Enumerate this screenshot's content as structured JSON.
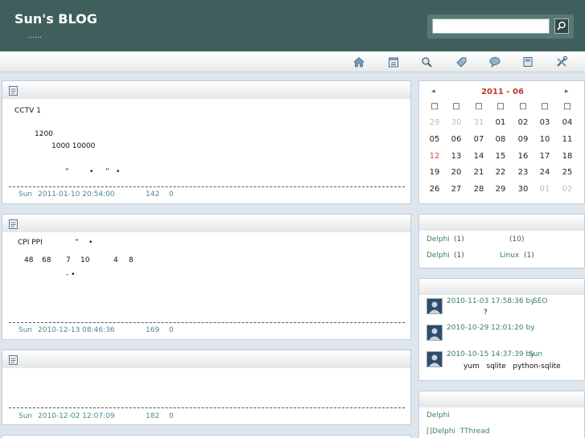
{
  "header": {
    "title": "Sun's BLOG",
    "subtitle": "……",
    "search_placeholder": ""
  },
  "nav": {
    "icons": [
      "home-icon",
      "calendar-icon",
      "search-icon",
      "tag-icon",
      "comment-icon",
      "archive-icon",
      "tools-icon"
    ]
  },
  "posts": [
    {
      "lines": [
        "CCTV 1",
        "1200",
        "1000 10000",
        "”",
        "•",
        "”",
        "•"
      ],
      "author": "Sun",
      "date": "2011-01-10 20:54:00",
      "views": "142",
      "comments": "0"
    },
    {
      "lines": [
        "CPI PPI",
        "”",
        "•",
        "48",
        "68",
        "7",
        "10",
        "4",
        "8",
        "- •"
      ],
      "author": "Sun",
      "date": "2010-12-13 08:46:36",
      "views": "169",
      "comments": "0"
    },
    {
      "lines": [],
      "author": "Sun",
      "date": "2010-12-02 12:07:09",
      "views": "182",
      "comments": "0"
    }
  ],
  "calendar": {
    "title": "2011 - 06",
    "prev": "◂",
    "next": "▸",
    "weekdays": [
      "□",
      "□",
      "□",
      "□",
      "□",
      "□",
      "□"
    ],
    "rows": [
      [
        "29",
        "30",
        "31",
        "01",
        "02",
        "03",
        "04"
      ],
      [
        "05",
        "06",
        "07",
        "08",
        "09",
        "10",
        "11"
      ],
      [
        "12",
        "13",
        "14",
        "15",
        "16",
        "17",
        "18"
      ],
      [
        "19",
        "20",
        "21",
        "22",
        "23",
        "24",
        "25"
      ],
      [
        "26",
        "27",
        "28",
        "29",
        "30",
        "01",
        "02"
      ]
    ],
    "dim_prefix": 3,
    "dim_suffix": 2,
    "today": "12"
  },
  "categories": {
    "row1": {
      "name": "Delphi",
      "count": "(1)",
      "extra": "(10)"
    },
    "row2": {
      "name": "Delphi",
      "count": "(1)",
      "name2": "Linux",
      "count2": "(1)"
    }
  },
  "comments": [
    {
      "meta": "2010-11-03 17:58:36 by",
      "author": "SEO",
      "text": "?"
    },
    {
      "meta": "2010-10-29 12:01:20 by",
      "author": "",
      "text": ""
    },
    {
      "meta": "2010-10-15 14:37:39 by",
      "author": "Sun",
      "text": "yum   sqlite   python-sqlite"
    }
  ],
  "recent": {
    "item1": "Delphi",
    "item2": "[]Delphi  TThread"
  },
  "colors": {
    "header_bg": "#3f5f5d",
    "link": "#3a8060",
    "meta": "#4a8a98",
    "calendar_title": "#c0392b"
  }
}
